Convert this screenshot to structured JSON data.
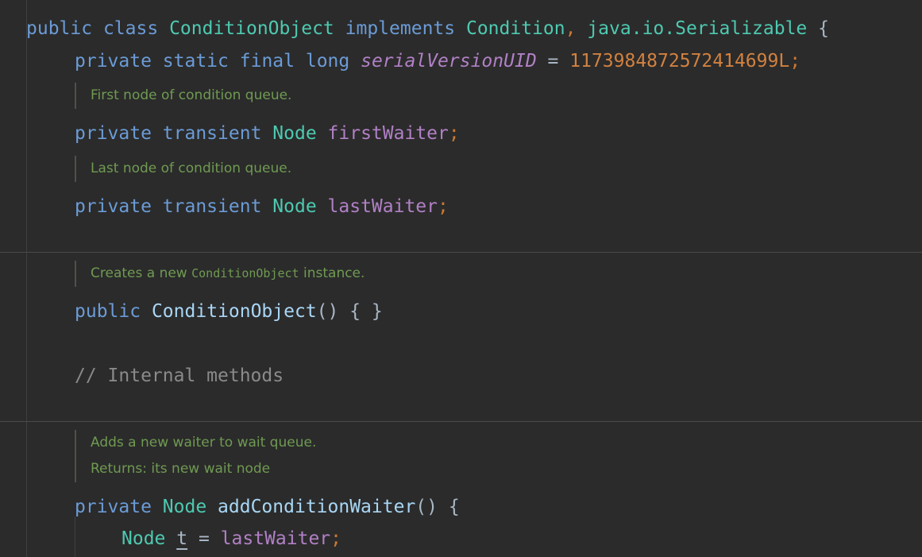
{
  "colors": {
    "background": "#2b2b2b",
    "keyword": "#6b9bd6",
    "type": "#4ec9b0",
    "field": "#b180c6",
    "number": "#d2813f",
    "doc_comment": "#6f9a52",
    "line_comment": "#8a8a8a",
    "method": "#a9d6f5",
    "punctuation": "#a9b7c6"
  },
  "lines": {
    "class_decl": {
      "public": "public",
      "class": "class",
      "name": "ConditionObject",
      "implements": "implements",
      "iface1": "Condition",
      "comma": ",",
      "iface2": "java.io.Serializable",
      "brace": "{"
    },
    "serial": {
      "private": "private",
      "static": "static",
      "final": "final",
      "long": "long",
      "name": "serialVersionUID",
      "eq": "=",
      "value": "1173984872572414699L",
      "semi": ";"
    },
    "first_waiter": {
      "private": "private",
      "transient": "transient",
      "type": "Node",
      "name": "firstWaiter",
      "semi": ";"
    },
    "last_waiter": {
      "private": "private",
      "transient": "transient",
      "type": "Node",
      "name": "lastWaiter",
      "semi": ";"
    },
    "constructor": {
      "public": "public",
      "name": "ConditionObject",
      "parens": "()",
      "body": "{ }"
    },
    "internal_comment": "// Internal methods",
    "add_waiter": {
      "private": "private",
      "type": "Node",
      "name": "addConditionWaiter",
      "parens": "()",
      "brace": "{"
    },
    "node_t": {
      "type": "Node",
      "var": "t",
      "eq": "=",
      "value": "lastWaiter",
      "semi": ";"
    }
  },
  "docs": {
    "first_waiter": "First node of condition queue.",
    "last_waiter": "Last node of condition queue.",
    "constructor_prefix": "Creates a new",
    "constructor_code": "ConditionObject",
    "constructor_suffix": "instance.",
    "add_waiter_1": "Adds a new waiter to wait queue.",
    "add_waiter_2": "Returns: its new wait node"
  }
}
